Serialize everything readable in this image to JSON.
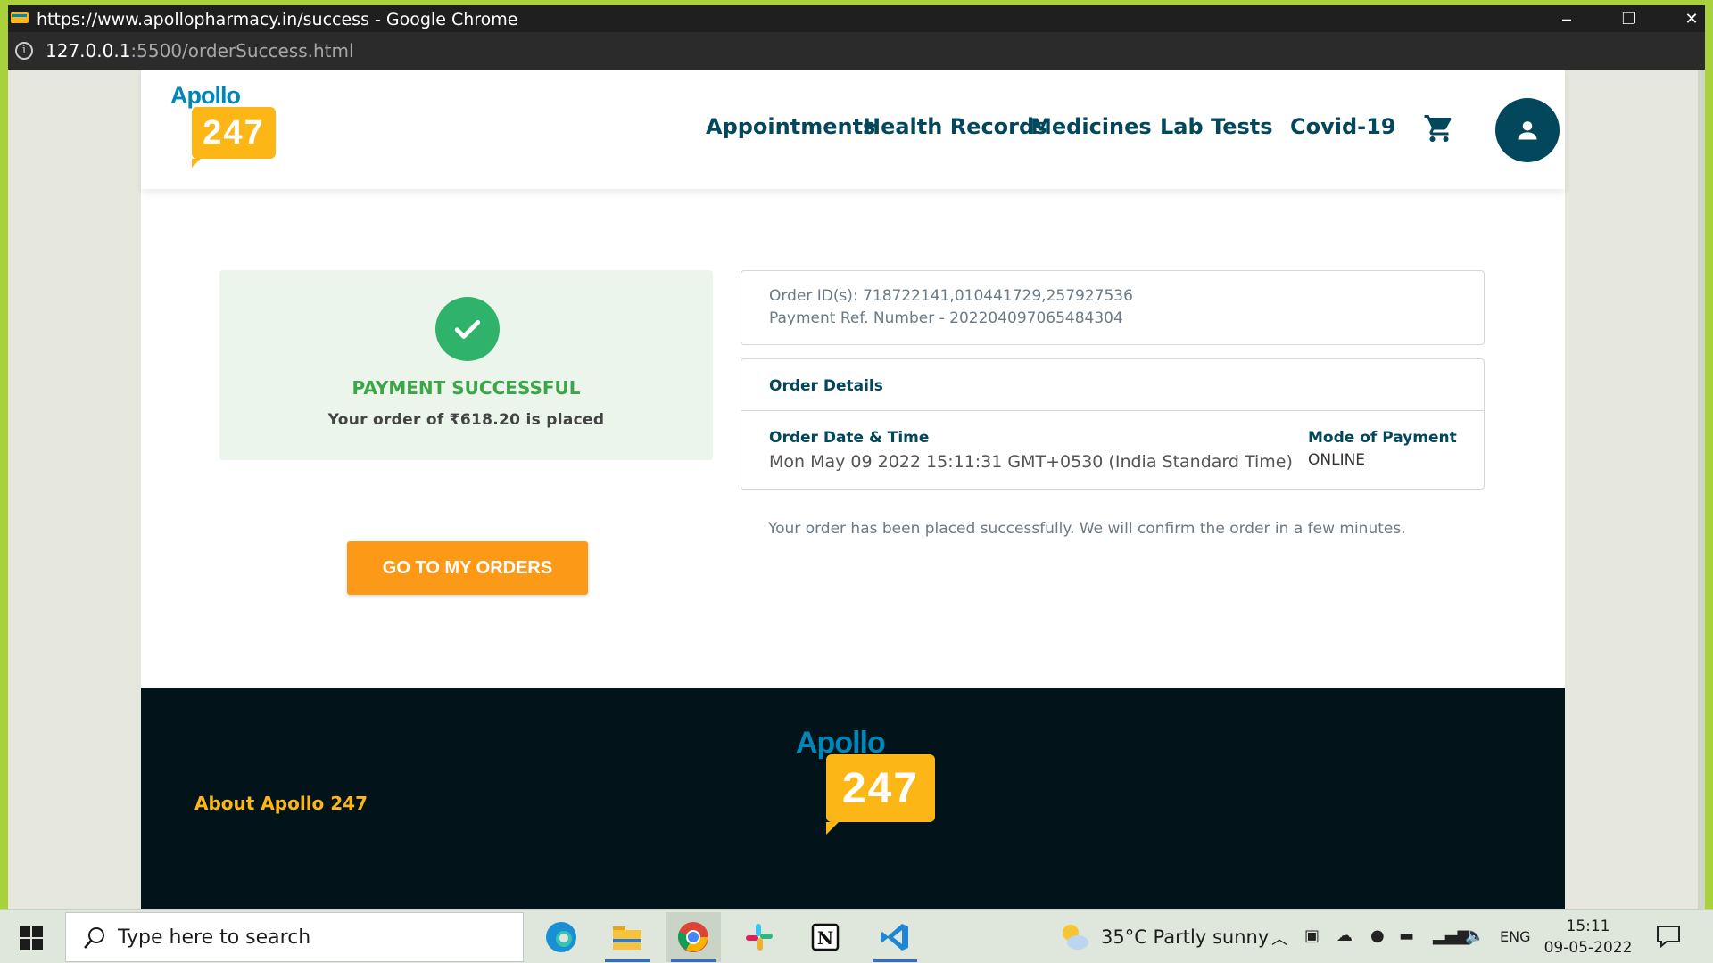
{
  "browser": {
    "window_title": "https://www.apollopharmacy.in/success - Google Chrome",
    "url_host": "127.0.0.1",
    "url_path": ":5500/orderSuccess.html",
    "controls": {
      "minimize": "–",
      "restore": "❐",
      "close": "✕"
    }
  },
  "header": {
    "logo_top": "Apollo",
    "logo_num": "247",
    "nav": [
      {
        "label": "Appointments"
      },
      {
        "label": "Health Records"
      },
      {
        "label": "Medicines"
      },
      {
        "label": "Lab Tests"
      },
      {
        "label": "Covid-19"
      }
    ],
    "icons": {
      "cart": "cart-icon",
      "profile": "user-icon"
    }
  },
  "success": {
    "title": "PAYMENT SUCCESSFUL",
    "subtitle": "Your order of ₹618.20 is placed",
    "icon": "check-icon"
  },
  "actions": {
    "go_to_orders": "GO TO MY ORDERS"
  },
  "order": {
    "ids_line": "Order ID(s): 718722141,010441729,257927536",
    "payment_ref_line": "Payment Ref. Number - 202204097065484304",
    "details_heading": "Order Details",
    "date_label": "Order Date & Time",
    "date_value": "Mon May 09 2022 15:11:31 GMT+0530 (India Standard Time)",
    "mode_label": "Mode of Payment",
    "mode_value": "ONLINE",
    "note": "Your order has been placed successfully. We will confirm the order in a few minutes."
  },
  "footer": {
    "logo_top": "Apollo",
    "logo_num": "247",
    "about": "About Apollo 247"
  },
  "taskbar": {
    "search_placeholder": "Type here to search",
    "apps": [
      "edge-icon",
      "file-explorer-icon",
      "chrome-icon",
      "slack-icon",
      "notion-icon",
      "vscode-icon"
    ],
    "weather": "35°C  Partly sunny",
    "language": "ENG",
    "time": "15:11",
    "date": "09-05-2022"
  },
  "colors": {
    "brand_dark": "#02475b",
    "brand_orange": "#fc9916",
    "brand_yellow": "#fcb716",
    "success_green": "#3aa647",
    "logo_blue": "#0087ba"
  }
}
